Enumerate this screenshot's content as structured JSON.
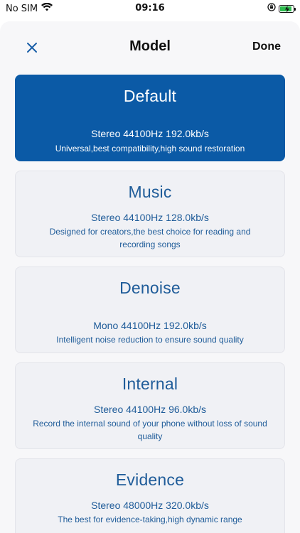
{
  "status_bar": {
    "carrier": "No SIM",
    "time": "09:16"
  },
  "header": {
    "title": "Model",
    "done_label": "Done"
  },
  "models": [
    {
      "name": "Default",
      "spec": "Stereo 44100Hz 192.0kb/s",
      "desc": "Universal,best compatibility,high sound restoration",
      "selected": true
    },
    {
      "name": "Music",
      "spec": "Stereo 44100Hz 128.0kb/s",
      "desc": "Designed for creators,the best choice for reading and recording songs",
      "selected": false
    },
    {
      "name": "Denoise",
      "spec": "Mono 44100Hz 192.0kb/s",
      "desc": "Intelligent noise reduction to ensure sound quality",
      "selected": false
    },
    {
      "name": "Internal",
      "spec": "Stereo 44100Hz 96.0kb/s",
      "desc": "Record the internal sound of your phone without loss of sound quality",
      "selected": false
    },
    {
      "name": "Evidence",
      "spec": "Stereo 48000Hz 320.0kb/s",
      "desc": "The best for evidence-taking,high dynamic range",
      "selected": false
    }
  ],
  "colors": {
    "selected_bg": "#0b5aa6",
    "card_text": "#1f5c99",
    "battery_green": "#2dbb4e"
  }
}
